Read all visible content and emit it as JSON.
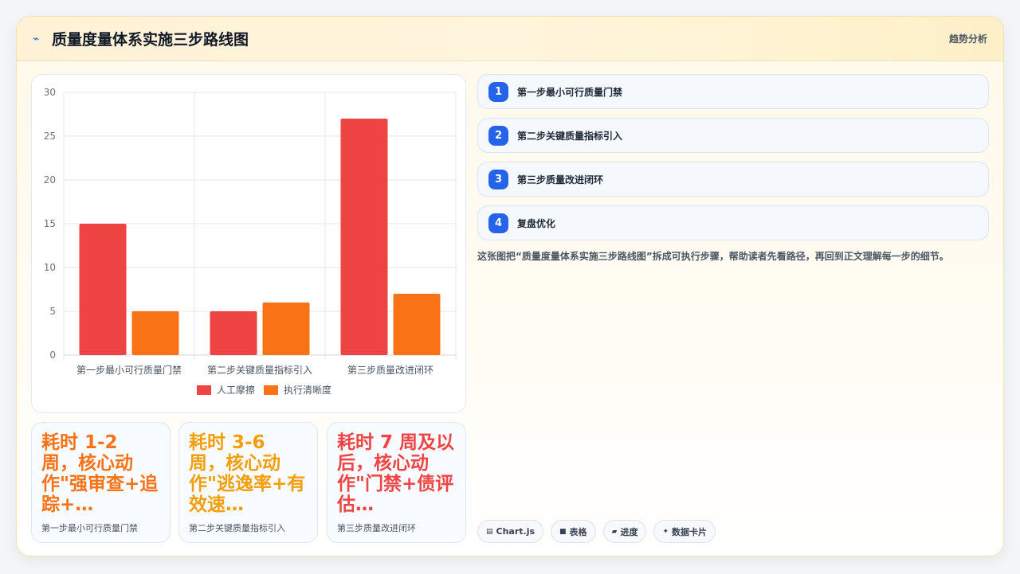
{
  "header": {
    "title": "质量度量体系实施三步路线图",
    "trend_label": "趋势分析",
    "icon": "trend-line-icon"
  },
  "chart_data": {
    "type": "bar",
    "categories": [
      "第一步最小可行质量门禁",
      "第二步关键质量指标引入",
      "第三步质量改进闭环"
    ],
    "series": [
      {
        "name": "人工摩擦",
        "values": [
          15,
          5,
          27
        ],
        "color": "#ef4444"
      },
      {
        "name": "执行清晰度",
        "values": [
          5,
          6,
          7
        ],
        "color": "#f97316"
      }
    ],
    "ylim": [
      0,
      30
    ],
    "yticks": [
      0,
      5,
      10,
      15,
      20,
      25,
      30
    ],
    "grid": true,
    "legend_position": "bottom"
  },
  "stats": [
    {
      "value": "耗时 1-2 周，核心动作\"强审查+追踪+…",
      "label": "第一步最小可行质量门禁",
      "color": "#f97316"
    },
    {
      "value": "耗时 3-6 周，核心动作\"逃逸率+有效速…",
      "label": "第二步关键质量指标引入",
      "color": "#f59e0b"
    },
    {
      "value": "耗时 7 周及以后，核心动作\"门禁+债评估…",
      "label": "第三步质量改进闭环",
      "color": "#ef4444"
    }
  ],
  "steps": [
    {
      "num": "1",
      "label": "第一步最小可行质量门禁"
    },
    {
      "num": "2",
      "label": "第二步关键质量指标引入"
    },
    {
      "num": "3",
      "label": "第三步质量改进闭环"
    },
    {
      "num": "4",
      "label": "复盘优化"
    }
  ],
  "description": "这张图把“质量度量体系实施三步路线图”拆成可执行步骤，帮助读者先看路径，再回到正文理解每一步的细节。",
  "tags": [
    {
      "icon": "chart-icon",
      "glyph": "▤",
      "label": "Chart.js"
    },
    {
      "icon": "table-icon",
      "glyph": "■",
      "label": "表格"
    },
    {
      "icon": "progress-icon",
      "glyph": "▰",
      "label": "进度"
    },
    {
      "icon": "sparkle-icon",
      "glyph": "✦",
      "label": "数据卡片"
    }
  ]
}
